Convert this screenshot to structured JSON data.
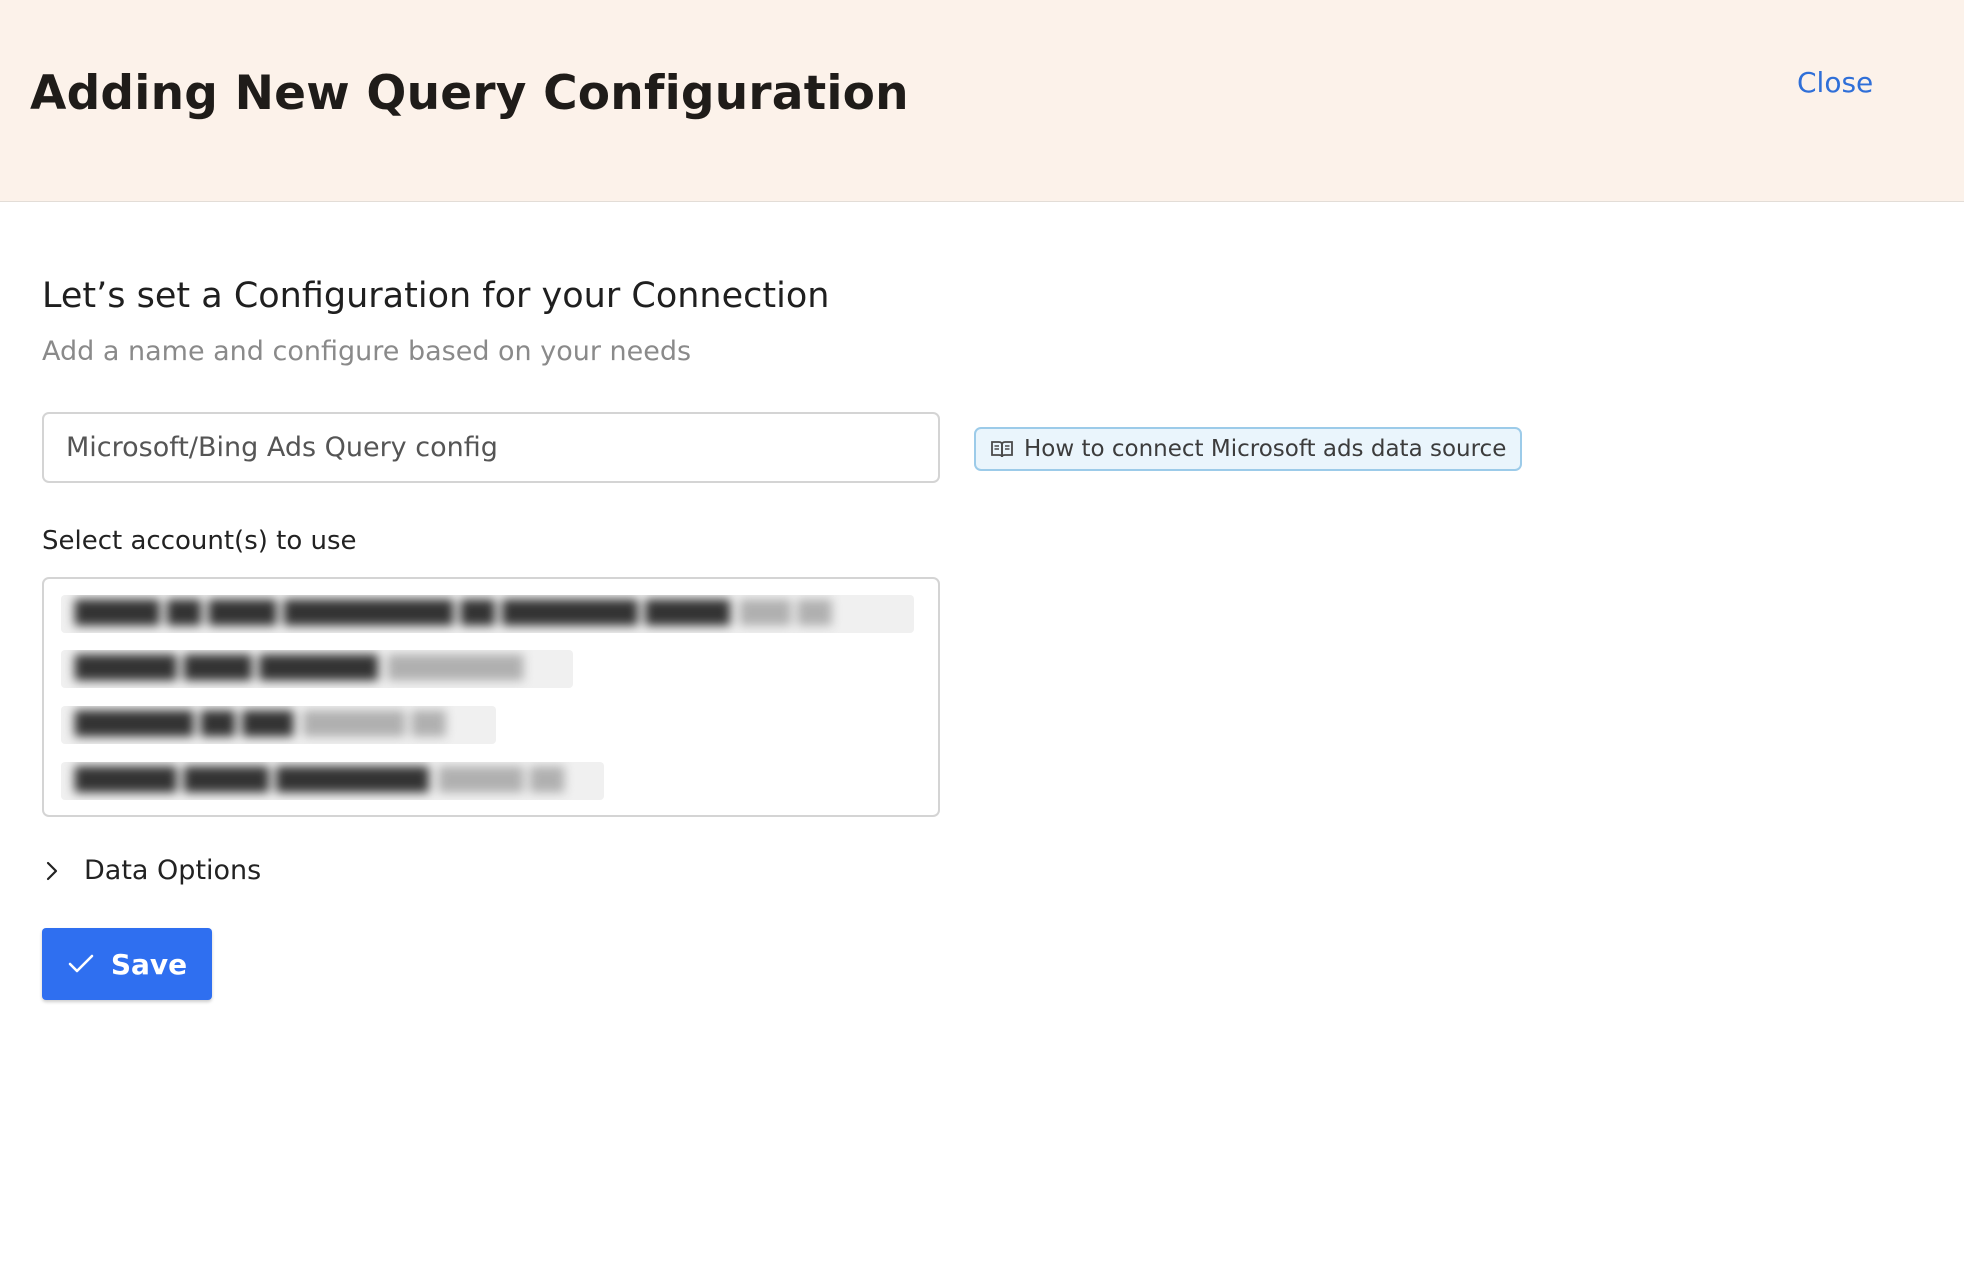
{
  "header": {
    "title": "Adding New Query Configuration",
    "close_label": "Close"
  },
  "form": {
    "title": "Let’s set a Configuration for your Connection",
    "subtitle": "Add a name and configure based on your needs",
    "name_value": "Microsoft/Bing Ads Query config",
    "help_link_label": "How to connect Microsoft ads data source",
    "accounts_label": "Select account(s) to use",
    "data_options_label": "Data Options",
    "save_label": "Save"
  },
  "icons": {
    "help": "book-icon",
    "data_options": "chevron-right-icon",
    "save": "checkmark-icon"
  },
  "colors": {
    "header_background": "#fcf2ea",
    "accent": "#2f6ff0",
    "link": "#2f6fd8",
    "help_background": "#eaf5fc",
    "help_border": "#9ccbe9"
  }
}
